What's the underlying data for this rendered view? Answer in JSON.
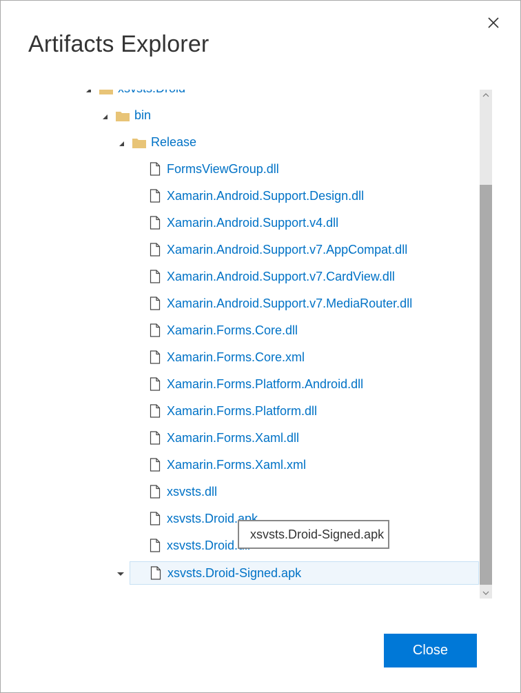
{
  "dialog": {
    "title": "Artifacts Explorer",
    "close_button_label": "Close"
  },
  "tree": {
    "folders": [
      {
        "label": "xsvsts.Droid",
        "expanded": true
      },
      {
        "label": "bin",
        "expanded": true
      },
      {
        "label": "Release",
        "expanded": true
      }
    ],
    "files": [
      {
        "label": "FormsViewGroup.dll"
      },
      {
        "label": "Xamarin.Android.Support.Design.dll"
      },
      {
        "label": "Xamarin.Android.Support.v4.dll"
      },
      {
        "label": "Xamarin.Android.Support.v7.AppCompat.dll"
      },
      {
        "label": "Xamarin.Android.Support.v7.CardView.dll"
      },
      {
        "label": "Xamarin.Android.Support.v7.MediaRouter.dll"
      },
      {
        "label": "Xamarin.Forms.Core.dll"
      },
      {
        "label": "Xamarin.Forms.Core.xml"
      },
      {
        "label": "Xamarin.Forms.Platform.Android.dll"
      },
      {
        "label": "Xamarin.Forms.Platform.dll"
      },
      {
        "label": "Xamarin.Forms.Xaml.dll"
      },
      {
        "label": "Xamarin.Forms.Xaml.xml"
      },
      {
        "label": "xsvsts.dll"
      },
      {
        "label": "xsvsts.Droid.apk"
      },
      {
        "label": "xsvsts.Droid.dll"
      },
      {
        "label": "xsvsts.Droid-Signed.apk",
        "selected": true
      }
    ]
  },
  "tooltip": {
    "text": "xsvsts.Droid-Signed.apk"
  },
  "colors": {
    "link": "#0072c6",
    "folder": "#e8c477",
    "primary_button": "#0078d7",
    "selection_bg": "#eff6fc",
    "selection_border": "#c7e0f4"
  },
  "icons": {
    "close": "close-icon",
    "folder": "folder-icon",
    "file": "file-icon",
    "expanded_arrow": "expanded-arrow-icon",
    "scroll_up": "chevron-up-icon",
    "scroll_down": "chevron-down-icon"
  }
}
